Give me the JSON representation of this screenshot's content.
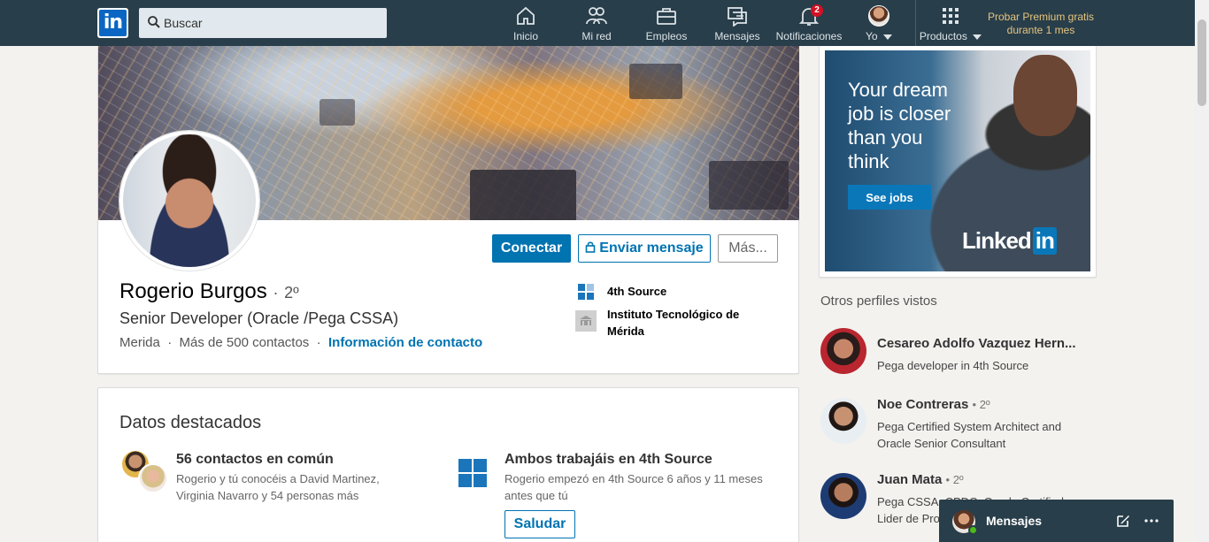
{
  "nav": {
    "search_placeholder": "Buscar",
    "items": [
      {
        "label": "Inicio",
        "icon": "home-icon"
      },
      {
        "label": "Mi red",
        "icon": "network-icon"
      },
      {
        "label": "Empleos",
        "icon": "briefcase-icon"
      },
      {
        "label": "Mensajes",
        "icon": "messaging-icon"
      },
      {
        "label": "Notificaciones",
        "icon": "bell-icon",
        "badge": "2"
      },
      {
        "label": "Yo",
        "icon": "avatar"
      },
      {
        "label": "Productos",
        "icon": "grid-icon"
      }
    ],
    "premium_line1": "Probar Premium gratis",
    "premium_line2": "durante 1 mes"
  },
  "profile": {
    "name": "Rogerio Burgos",
    "degree": "2º",
    "headline": "Senior Developer (Oracle /Pega CSSA)",
    "location": "Merida",
    "connections": "Más de 500 contactos",
    "contact_info": "Información de contacto",
    "buttons": {
      "connect": "Conectar",
      "message": "Enviar mensaje",
      "more": "Más..."
    },
    "company": "4th Source",
    "school_line1": "Instituto Tecnológico de",
    "school_line2": "Mérida"
  },
  "highlights": {
    "title": "Datos destacados",
    "mutual": {
      "title": "56 contactos en común",
      "line1": "Rogerio y tú conocéis a David Martinez,",
      "line2": "Virginia Navarro y 54 personas más"
    },
    "worked": {
      "title": "Ambos trabajáis en 4th Source",
      "line1": "Rogerio empezó en 4th Source 6 años y 11 meses",
      "line2": "antes que tú",
      "button": "Saludar"
    }
  },
  "ad": {
    "line1": "Your dream",
    "line2": "job is closer",
    "line3": "than you",
    "line4": "think",
    "button": "See jobs",
    "logo_text": "Linked",
    "logo_in": "in"
  },
  "people_also_viewed": {
    "title": "Otros perfiles vistos",
    "people": [
      {
        "name": "Cesareo Adolfo Vazquez Hern...",
        "degree": "",
        "line1": "Pega developer in 4th Source",
        "line2": ""
      },
      {
        "name": "Noe Contreras",
        "degree": "• 2º",
        "line1": "Pega Certified System Architect and",
        "line2": "Oracle Senior Consultant"
      },
      {
        "name": "Juan Mata",
        "degree": "• 2º",
        "line1": "Pega CSSA, CPDC, Oracle Certified",
        "line2": "Lider de Pro"
      }
    ]
  },
  "messaging": {
    "label": "Mensajes"
  },
  "colors": {
    "nav_bg": "#283e4a",
    "accent": "#0073b1",
    "badge": "#d11124",
    "premium": "#e7c47e"
  }
}
